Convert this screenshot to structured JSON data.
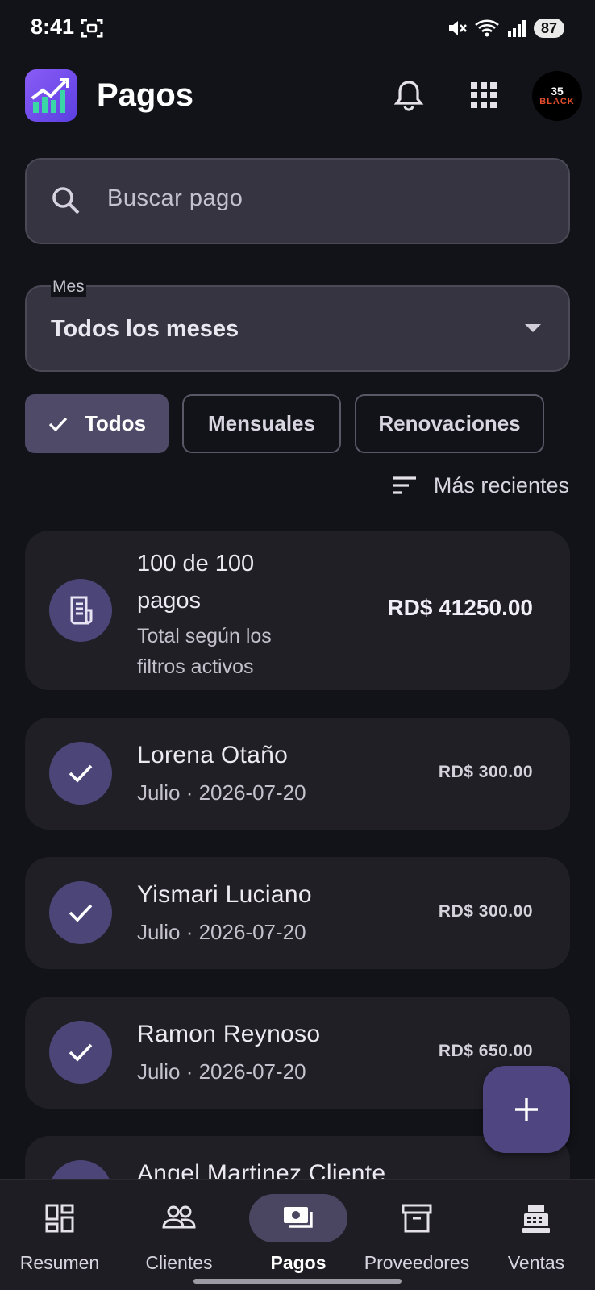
{
  "status_bar": {
    "time": "8:41",
    "battery": "87",
    "icons": [
      "screenshot-icon",
      "mute-icon",
      "wifi-icon",
      "signal-icon"
    ]
  },
  "app_bar": {
    "title": "Pagos",
    "logo_icon": "chart-growth-icon",
    "actions": [
      "bell-icon",
      "apps-grid-icon"
    ],
    "avatar": {
      "number": "35",
      "text": "BLACK"
    }
  },
  "search": {
    "placeholder": "Buscar pago"
  },
  "month_filter": {
    "label": "Mes",
    "value": "Todos los meses"
  },
  "chips": [
    {
      "label": "Todos",
      "selected": true
    },
    {
      "label": "Mensuales",
      "selected": false
    },
    {
      "label": "Renovaciones",
      "selected": false
    }
  ],
  "sort": {
    "label": "Más recientes"
  },
  "summary": {
    "title": "100 de 100 pagos",
    "subtitle": "Total según los filtros activos",
    "total": "RD$ 41250.00"
  },
  "payments": [
    {
      "name": "Lorena Otaño",
      "date": "Julio · 2026-07-20",
      "amount": "RD$ 300.00"
    },
    {
      "name": "Yismari Luciano",
      "date": "Julio · 2026-07-20",
      "amount": "RD$ 300.00"
    },
    {
      "name": "Ramon Reynoso",
      "date": "Julio · 2026-07-20",
      "amount": "RD$ 650.00"
    },
    {
      "name": "Angel Martinez Cliente",
      "date": "",
      "amount": ""
    }
  ],
  "fab": {
    "icon": "plus-icon"
  },
  "bottom_nav": [
    {
      "label": "Resumen",
      "icon": "dashboard-icon",
      "active": false
    },
    {
      "label": "Clientes",
      "icon": "people-icon",
      "active": false
    },
    {
      "label": "Pagos",
      "icon": "payments-icon",
      "active": true
    },
    {
      "label": "Proveedores",
      "icon": "archive-icon",
      "active": false
    },
    {
      "label": "Ventas",
      "icon": "cash-register-icon",
      "active": false
    }
  ],
  "colors": {
    "background": "#121318",
    "card": "#1f1f25",
    "accent": "#4f4580",
    "icon_circle": "#4c4578"
  }
}
